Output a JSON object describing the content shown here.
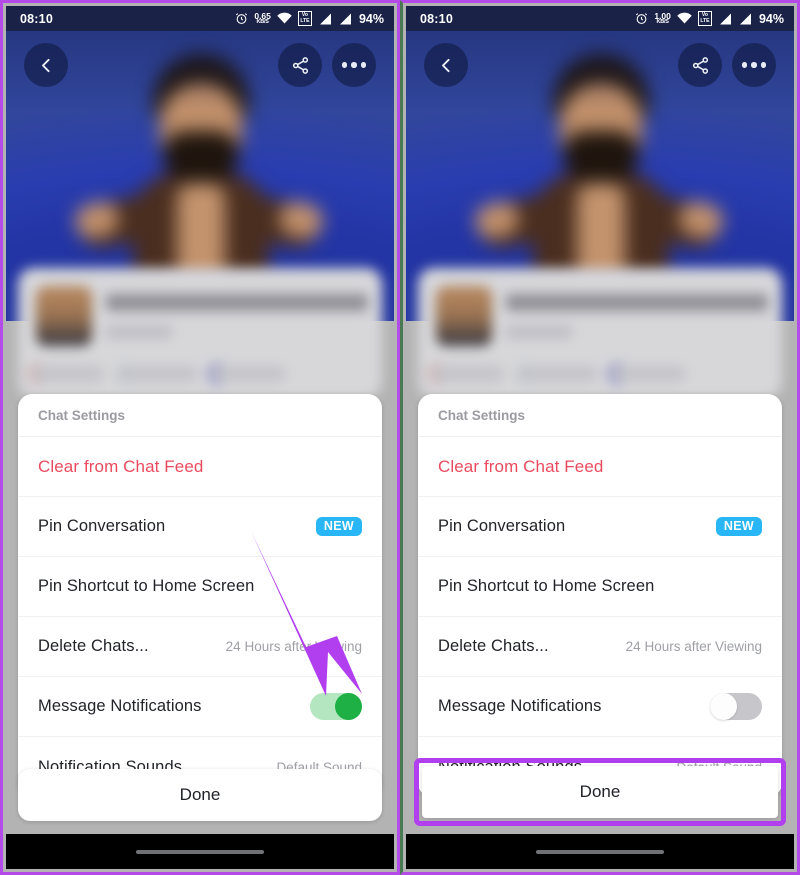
{
  "panels": [
    {
      "id": "before",
      "statusbar": {
        "time": "08:10",
        "alarm_icon": "alarm-clock-icon",
        "data_speed_value": "0.65",
        "data_speed_unit": "KB/S",
        "wifi_icon": "wifi-icon",
        "volte_top": "Vo",
        "volte_bottom": "LTE",
        "signal_icon_1": "signal-bars-icon",
        "signal_icon_2": "signal-bars-icon",
        "battery": "94%"
      },
      "topnav": {
        "back_icon": "back-chevron-icon",
        "share_icon": "share-icon",
        "more_icon": "more-options-icon"
      },
      "sheet": {
        "title": "Chat Settings",
        "rows": [
          {
            "label": "Clear from Chat Feed",
            "type": "destructive"
          },
          {
            "label": "Pin Conversation",
            "type": "badge",
            "badge": "NEW"
          },
          {
            "label": "Pin Shortcut to Home Screen",
            "type": "plain"
          },
          {
            "label": "Delete Chats...",
            "type": "value",
            "value": "24 Hours after Viewing"
          },
          {
            "label": "Message Notifications",
            "type": "toggle",
            "toggle_state": "on"
          },
          {
            "label": "Notification Sounds",
            "type": "value",
            "value": "Default Sound"
          }
        ]
      },
      "done_label": "Done",
      "done_highlighted": false,
      "annotation_arrow": true
    },
    {
      "id": "after",
      "statusbar": {
        "time": "08:10",
        "alarm_icon": "alarm-clock-icon",
        "data_speed_value": "1.00",
        "data_speed_unit": "KB/S",
        "wifi_icon": "wifi-icon",
        "volte_top": "Vo",
        "volte_bottom": "LTE",
        "signal_icon_1": "signal-bars-icon",
        "signal_icon_2": "signal-bars-icon",
        "battery": "94%"
      },
      "topnav": {
        "back_icon": "back-chevron-icon",
        "share_icon": "share-icon",
        "more_icon": "more-options-icon"
      },
      "sheet": {
        "title": "Chat Settings",
        "rows": [
          {
            "label": "Clear from Chat Feed",
            "type": "destructive"
          },
          {
            "label": "Pin Conversation",
            "type": "badge",
            "badge": "NEW"
          },
          {
            "label": "Pin Shortcut to Home Screen",
            "type": "plain"
          },
          {
            "label": "Delete Chats...",
            "type": "value",
            "value": "24 Hours after Viewing"
          },
          {
            "label": "Message Notifications",
            "type": "toggle",
            "toggle_state": "off"
          },
          {
            "label": "Notification Sounds",
            "type": "value",
            "value": "Default Sound"
          }
        ]
      },
      "done_label": "Done",
      "done_highlighted": true,
      "annotation_arrow": false
    }
  ],
  "colors": {
    "frame_purple": "#b44ae8",
    "frame_green": "#4a7a52",
    "annotation_purple": "#b13ff0",
    "destructive_red": "#e94b5e",
    "badge_blue": "#29b6f6",
    "toggle_on_track": "#b4e6c0",
    "toggle_on_knob": "#1eb045",
    "toggle_off_track": "#c6c6cb",
    "statusbar_bg": "#1b2247",
    "hero_blue": "#2a3aad",
    "sheet_bg": "#ffffff",
    "page_bg": "#b3b3b3",
    "navbar_bg": "#000000"
  }
}
